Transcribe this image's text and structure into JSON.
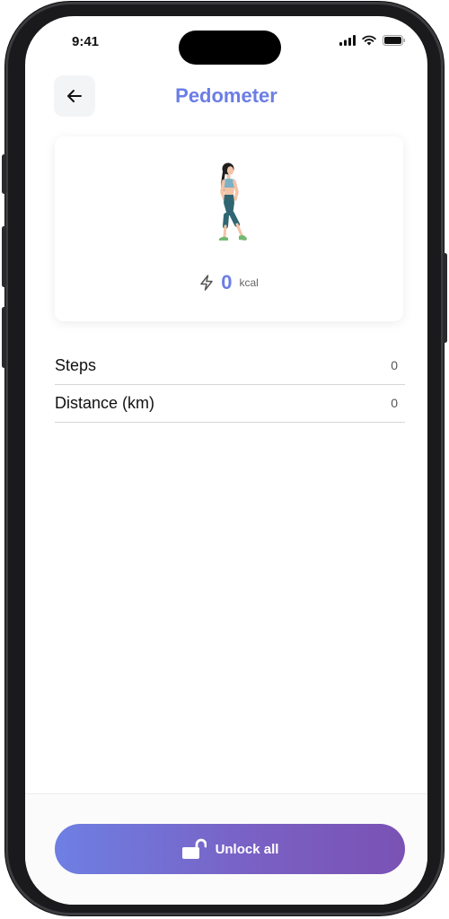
{
  "status_bar": {
    "time": "9:41"
  },
  "header": {
    "title": "Pedometer",
    "back_icon": "arrow-left-icon"
  },
  "summary": {
    "calories_value": "0",
    "calories_unit": "kcal",
    "calories_icon": "lightning-icon",
    "illustration": "walking-woman-illustration"
  },
  "stats": [
    {
      "label": "Steps",
      "value": "0"
    },
    {
      "label": "Distance (km)",
      "value": "0"
    }
  ],
  "footer": {
    "unlock_label": "Unlock all",
    "unlock_icon": "unlock-icon"
  },
  "colors": {
    "accent": "#6b7de6",
    "button_gradient_start": "#6e7fe3",
    "button_gradient_end": "#7a52b4"
  }
}
